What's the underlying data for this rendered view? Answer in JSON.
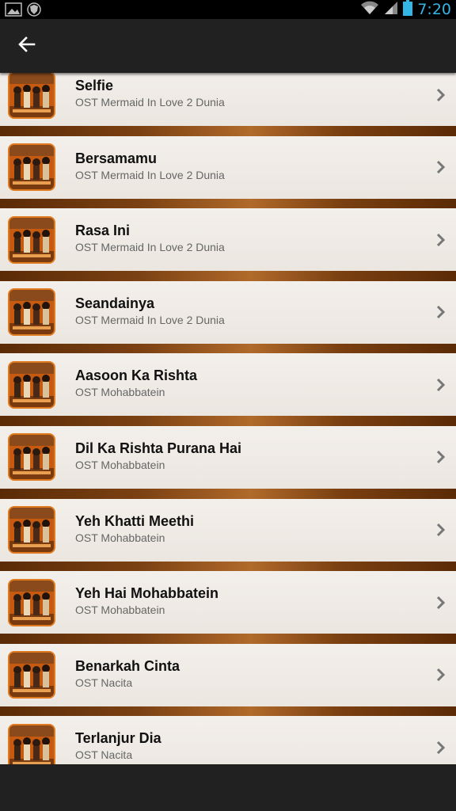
{
  "status_bar": {
    "time": "7:20",
    "left_icons": [
      "image-icon",
      "shield-icon"
    ],
    "right_icons": [
      "wifi-icon",
      "signal-icon",
      "battery-icon"
    ]
  },
  "action_bar": {
    "back_icon": "back-arrow-icon"
  },
  "songs": [
    {
      "title": "Selfie",
      "subtitle": "OST Mermaid In Love 2 Dunia"
    },
    {
      "title": "Bersamamu",
      "subtitle": "OST Mermaid In Love 2 Dunia"
    },
    {
      "title": "Rasa Ini",
      "subtitle": "OST Mermaid In Love 2 Dunia"
    },
    {
      "title": "Seandainya",
      "subtitle": "OST Mermaid In Love 2 Dunia"
    },
    {
      "title": "Aasoon Ka Rishta",
      "subtitle": "OST Mohabbatein"
    },
    {
      "title": "Dil Ka Rishta Purana Hai",
      "subtitle": "OST Mohabbatein"
    },
    {
      "title": "Yeh Khatti Meethi",
      "subtitle": "OST Mohabbatein"
    },
    {
      "title": "Yeh Hai Mohabbatein",
      "subtitle": "OST Mohabbatein"
    },
    {
      "title": "Benarkah Cinta",
      "subtitle": "OST Nacita"
    },
    {
      "title": "Terlanjur Dia",
      "subtitle": "OST Nacita"
    }
  ],
  "colors": {
    "accent": "#33b5e5",
    "action_bar": "#212121",
    "thumb_border": "#e07a1e"
  }
}
